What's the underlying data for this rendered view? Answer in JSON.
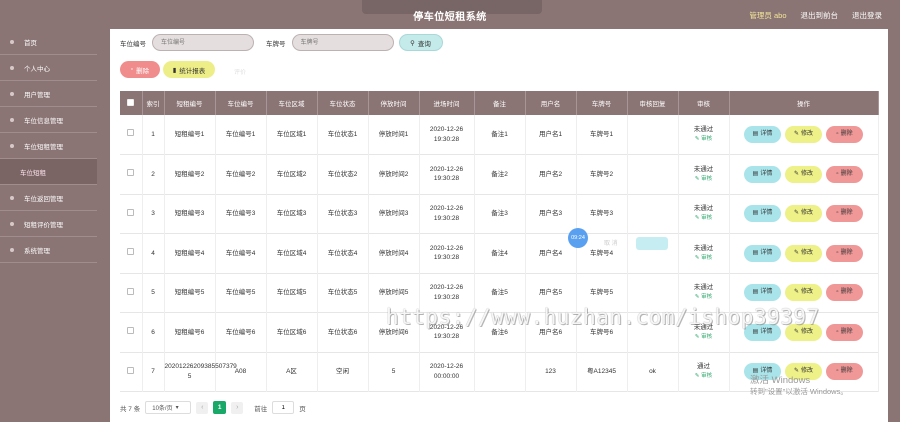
{
  "header": {
    "title": "停车位短租系统",
    "admin": "管理员 abo",
    "back_link": "退出到前台",
    "logout_link": "退出登录"
  },
  "sidebar": {
    "items": [
      {
        "label": "首页"
      },
      {
        "label": "个人中心"
      },
      {
        "label": "用户管理"
      },
      {
        "label": "车位信息管理"
      },
      {
        "label": "车位短租管理"
      },
      {
        "label": "车位短租",
        "sub": true
      },
      {
        "label": "车位返回管理"
      },
      {
        "label": "短租评价管理"
      },
      {
        "label": "系统管理"
      }
    ]
  },
  "search": {
    "label1": "车位编号",
    "placeholder1": "车位编号",
    "label2": "车牌号",
    "placeholder2": "车牌号",
    "query_label": "查询"
  },
  "actions": {
    "delete_label": "删除",
    "stats_label": "统计报表",
    "ghost_text": "评价"
  },
  "table": {
    "headers": [
      "索引",
      "短租编号",
      "车位编号",
      "车位区域",
      "车位状态",
      "停放时间",
      "进场时间",
      "备注",
      "用户名",
      "车牌号",
      "审核回复",
      "审核",
      "操作"
    ],
    "rows": [
      {
        "idx": "1",
        "no": "短租编号1",
        "space": "车位编号1",
        "area": "车位区域1",
        "status": "车位状态1",
        "duration": "停放时间1",
        "date": "2020-12-26",
        "time": "19:30:28",
        "remark": "备注1",
        "user": "用户名1",
        "plate": "车牌号1",
        "reply": "",
        "review": "未通过",
        "review_link": "审核"
      },
      {
        "idx": "2",
        "no": "短租编号2",
        "space": "车位编号2",
        "area": "车位区域2",
        "status": "车位状态2",
        "duration": "停放时间2",
        "date": "2020-12-26",
        "time": "19:30:28",
        "remark": "备注2",
        "user": "用户名2",
        "plate": "车牌号2",
        "reply": "",
        "review": "未通过",
        "review_link": "审核"
      },
      {
        "idx": "3",
        "no": "短租编号3",
        "space": "车位编号3",
        "area": "车位区域3",
        "status": "车位状态3",
        "duration": "停放时间3",
        "date": "2020-12-26",
        "time": "19:30:28",
        "remark": "备注3",
        "user": "用户名3",
        "plate": "车牌号3",
        "reply": "",
        "review": "未通过",
        "review_link": "审核"
      },
      {
        "idx": "4",
        "no": "短租编号4",
        "space": "车位编号4",
        "area": "车位区域4",
        "status": "车位状态4",
        "duration": "停放时间4",
        "date": "2020-12-26",
        "time": "19:30:28",
        "remark": "备注4",
        "user": "用户名4",
        "plate": "车牌号4",
        "reply": "",
        "review": "未通过",
        "review_link": "审核"
      },
      {
        "idx": "5",
        "no": "短租编号5",
        "space": "车位编号5",
        "area": "车位区域5",
        "status": "车位状态5",
        "duration": "停放时间5",
        "date": "2020-12-26",
        "time": "19:30:28",
        "remark": "备注5",
        "user": "用户名5",
        "plate": "车牌号5",
        "reply": "",
        "review": "未通过",
        "review_link": "审核"
      },
      {
        "idx": "6",
        "no": "短租编号6",
        "space": "车位编号6",
        "area": "车位区域6",
        "status": "车位状态6",
        "duration": "停放时间6",
        "date": "2020-12-26",
        "time": "19:30:28",
        "remark": "备注6",
        "user": "用户名6",
        "plate": "车牌号6",
        "reply": "",
        "review": "未通过",
        "review_link": "审核"
      },
      {
        "idx": "7",
        "no": "20201226209385507379 5",
        "space": "A08",
        "area": "A区",
        "status": "空闲",
        "duration": "5",
        "date": "2020-12-26",
        "time": "00:00:00",
        "remark": "",
        "user": "123",
        "plate": "粤A12345",
        "reply": "ok",
        "review": "通过",
        "review_link": "审核"
      }
    ],
    "op_detail": "详情",
    "op_edit": "修改",
    "op_delete": "删除"
  },
  "pager": {
    "total": "共 7 条",
    "size": "10条/页",
    "current": "1",
    "goto_label": "前往",
    "goto_value": "1",
    "page_suffix": "页"
  },
  "overlay": {
    "bubble": "09:24",
    "watermark": "https://www.huzhan.com/ishop39397",
    "activate_title": "激活 Windows",
    "activate_sub": "转到\"设置\"以激活 Windows。",
    "ghost_text": "取 消"
  },
  "colors": {
    "sidebar": "#8a7474",
    "accent_green": "#18a868",
    "detail": "#a8e4ea",
    "edit": "#eef088",
    "delete": "#f09898"
  }
}
